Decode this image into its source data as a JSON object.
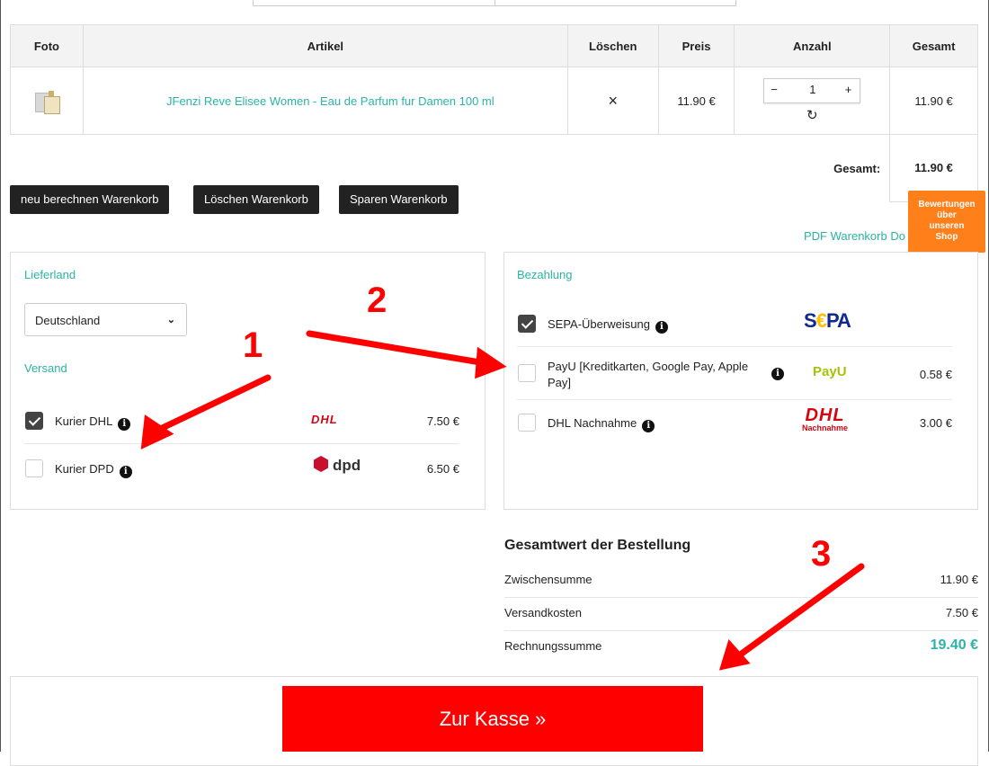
{
  "cart": {
    "headers": {
      "foto": "Foto",
      "artikel": "Artikel",
      "loeschen": "Löschen",
      "preis": "Preis",
      "anzahl": "Anzahl",
      "gesamt": "Gesamt"
    },
    "item": {
      "name": "JFenzi Reve Elisee Women - Eau de Parfum fur Damen 100 ml",
      "remove_icon": "×",
      "price": "11.90 €",
      "qty_minus": "−",
      "qty": "1",
      "qty_plus": "+",
      "refresh_icon": "↻",
      "total": "11.90 €"
    },
    "total_label": "Gesamt:",
    "total_value": "11.90 €"
  },
  "buttons": {
    "recalc": "neu berechnen Warenkorb",
    "delete": "Löschen Warenkorb",
    "save": "Sparen Warenkorb"
  },
  "pdf_link": "PDF Warenkorb Do",
  "reviews_badge": {
    "line1": "Bewertungen",
    "line2": "über",
    "line3": "unseren",
    "line4": "Shop"
  },
  "shipping": {
    "country_title": "Lieferland",
    "country_value": "Deutschland",
    "versand_title": "Versand",
    "options": [
      {
        "label": "Kurier DHL",
        "price": "7.50 €",
        "checked": true,
        "logo": "DHL"
      },
      {
        "label": "Kurier DPD",
        "price": "6.50 €",
        "checked": false,
        "logo": "dpd"
      }
    ]
  },
  "payment": {
    "title": "Bezahlung",
    "options": [
      {
        "label": "SEPA-Überweisung",
        "price": "",
        "checked": true,
        "logo": "SEPA"
      },
      {
        "label_line1": "PayU [Kreditkarten, Google Pay, Apple",
        "label_line2": "Pay]",
        "price": "0.58 €",
        "checked": false,
        "logo": "PayU"
      },
      {
        "label": "DHL Nachnahme",
        "price": "3.00 €",
        "checked": false,
        "logo": "DHL",
        "logo_sub": "Nachnahme"
      }
    ]
  },
  "summary": {
    "title": "Gesamtwert der Bestellung",
    "rows": [
      {
        "label": "Zwischensumme",
        "value": "11.90 €"
      },
      {
        "label": "Versandkosten",
        "value": "7.50 €"
      },
      {
        "label": "Rechnungssumme",
        "value": "19.40 €"
      }
    ]
  },
  "checkout": {
    "label": "Zur Kasse »"
  },
  "annotations": [
    "1",
    "2",
    "3"
  ],
  "colors": {
    "accent": "#2bb3a5",
    "checkout": "#ff0000",
    "badge": "#ff7f1a",
    "annotation": "#ff0000"
  }
}
